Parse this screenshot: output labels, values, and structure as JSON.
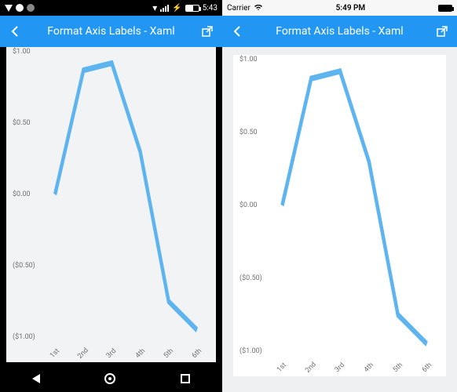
{
  "android": {
    "status": {
      "time": "5:43",
      "wifi": "▾",
      "batt_bolt": "⚡"
    },
    "appbar": {
      "title": "Format Axis Labels - Xaml"
    }
  },
  "ios": {
    "status": {
      "carrier": "Carrier",
      "time": "5:49 PM"
    },
    "appbar": {
      "title": "Format Axis Labels - Xaml"
    }
  },
  "chart_data": {
    "type": "line",
    "categories": [
      "1st",
      "2nd",
      "3rd",
      "4th",
      "5th",
      "6th"
    ],
    "values": [
      0.0,
      0.87,
      0.92,
      0.3,
      -0.75,
      -0.95
    ],
    "ylim": [
      -1.0,
      1.0
    ],
    "yticks": [
      1.0,
      0.5,
      0.0,
      -0.5,
      -1.0
    ],
    "ytick_labels": [
      "$1.00",
      "$0.50",
      "$0.00",
      "($0.50)",
      "($1.00)"
    ],
    "xlabel": "",
    "ylabel": "",
    "title": ""
  }
}
